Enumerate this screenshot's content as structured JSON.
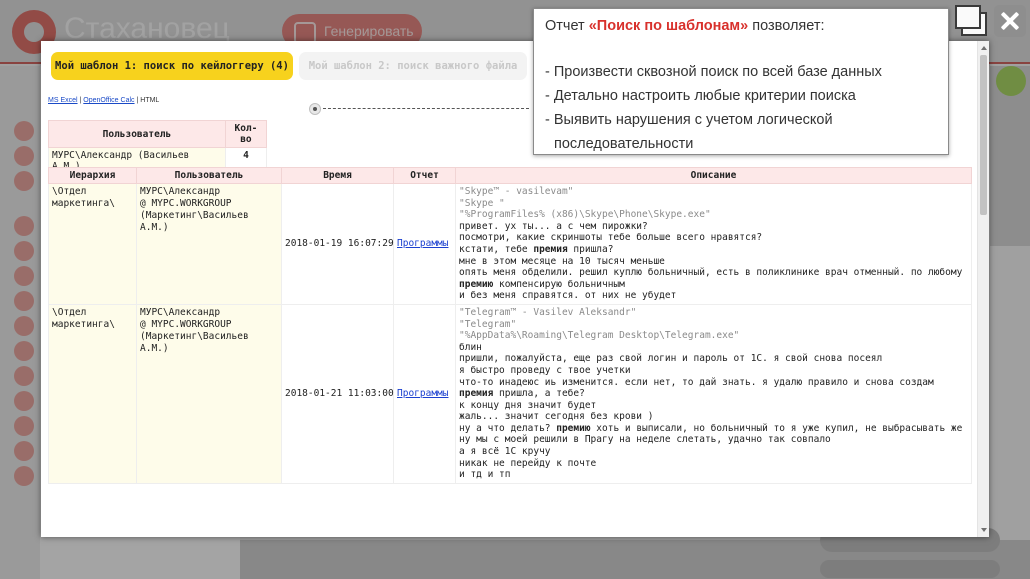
{
  "app": {
    "brand": "Стахановец",
    "generate_label": "Генерировать"
  },
  "tabs": [
    {
      "label": "Мой шаблон 1: поиск по кейлоггеру (4)",
      "active": true
    },
    {
      "label": "Мой шаблон 2: поиск важного файла",
      "active": false
    }
  ],
  "export": {
    "ms_excel": "MS Excel",
    "separator": "|",
    "openoffice": "OpenOffice Calc",
    "html": "HTML"
  },
  "summary": {
    "headers": [
      "Пользователь",
      "Кол-во"
    ],
    "rows": [
      {
        "user": "МУРС\\Александр (Васильев А.М.)",
        "count": "4"
      }
    ]
  },
  "results": {
    "headers": [
      "Иерархия",
      "Пользователь",
      "Время",
      "Отчет",
      "Описание"
    ],
    "rows": [
      {
        "hierarchy": "\\Отдел маркетинга\\",
        "user": [
          "МУРС\\Александр",
          "@ MYPC.WORKGROUP",
          "(Маркетинг\\Васильев А.М.)"
        ],
        "time": "2018-01-19 16:07:29",
        "report": "Программы",
        "desc_gray": [
          "\"Skype™ - vasilevam\"",
          "\"Skype \"",
          "\"%ProgramFiles% (x86)\\Skype\\Phone\\Skype.exe\""
        ],
        "desc_lines": [
          {
            "pre": "привет. ух ты... а с чем пирожки?",
            "bold": "",
            "post": ""
          },
          {
            "pre": "посмотри, какие скриншоты тебе больше всего нравятся?",
            "bold": "",
            "post": ""
          },
          {
            "pre": "кстати, тебе ",
            "bold": "премия",
            "post": " пришла?"
          },
          {
            "pre": "мне в этом месяце на 10 тысяч меньше",
            "bold": "",
            "post": ""
          },
          {
            "pre": "опять меня обделили. решил куплю больничный, есть в поликлинике врач отменный. по любому",
            "bold": "",
            "post": ""
          },
          {
            "pre": "",
            "bold": "премию",
            "post": " компенсирую больничным"
          },
          {
            "pre": "и без меня справятся. от них не убудет",
            "bold": "",
            "post": ""
          }
        ]
      },
      {
        "hierarchy": "\\Отдел маркетинга\\",
        "user": [
          "МУРС\\Александр",
          "@ MYPC.WORKGROUP",
          "(Маркетинг\\Васильев А.М.)"
        ],
        "time": "2018-01-21 11:03:00",
        "report": "Программы",
        "desc_gray": [
          "\"Telegram™ - Vasilev Aleksandr\"",
          "\"Telegram\"",
          "\"%AppData%\\Roaming\\Telegram Desktop\\Telegram.exe\""
        ],
        "desc_lines": [
          {
            "pre": "блин",
            "bold": "",
            "post": ""
          },
          {
            "pre": "пришли, пожалуйста, еще раз свой логин и пароль от 1С. я свой снова посеял",
            "bold": "",
            "post": ""
          },
          {
            "pre": "я быстро проведу с твое учетки",
            "bold": "",
            "post": ""
          },
          {
            "pre": "что-то инадеюс иь изменится. если нет, то дай знать. я удалю правило и снова создам",
            "bold": "",
            "post": ""
          },
          {
            "pre": "",
            "bold": "премия",
            "post": " пришла, а тебе?"
          },
          {
            "pre": "к концу дня значит будет",
            "bold": "",
            "post": ""
          },
          {
            "pre": "жаль... значит сегодня без крови )",
            "bold": "",
            "post": ""
          },
          {
            "pre": "ну а что делать? ",
            "bold": "премию",
            "post": " хоть и выписали, но больничный то я уже купил, не выбрасывать же"
          },
          {
            "pre": "ну мы с моей решили в Прагу на неделе слетать, удачно так совпало",
            "bold": "",
            "post": ""
          },
          {
            "pre": "а я всё 1С кручу",
            "bold": "",
            "post": ""
          },
          {
            "pre": "никак не перейду к почте",
            "bold": "",
            "post": ""
          },
          {
            "pre": "и тд и тп",
            "bold": "",
            "post": ""
          }
        ]
      }
    ]
  },
  "tooltip": {
    "title_pre": "Отчет ",
    "title_accent": "«Поиск по шаблонам»",
    "title_post": " позволяет:",
    "bullets": [
      "- Произвести сквозной поиск по всей базе данных",
      "- Детально настроить любые критерии поиска",
      "- Выявить нарушения с учетом логической",
      "последовательности"
    ]
  },
  "colors": {
    "accent_red": "#d8312c",
    "tab_yellow": "#f7d21d",
    "header_pink": "#fde8e8",
    "cell_cream": "#fefcea",
    "link_blue": "#1a3fd0"
  },
  "icons": {
    "restore": "window-restore-icon",
    "close": "close-icon",
    "logo": "brand-logo-icon",
    "generate": "generate-icon"
  }
}
